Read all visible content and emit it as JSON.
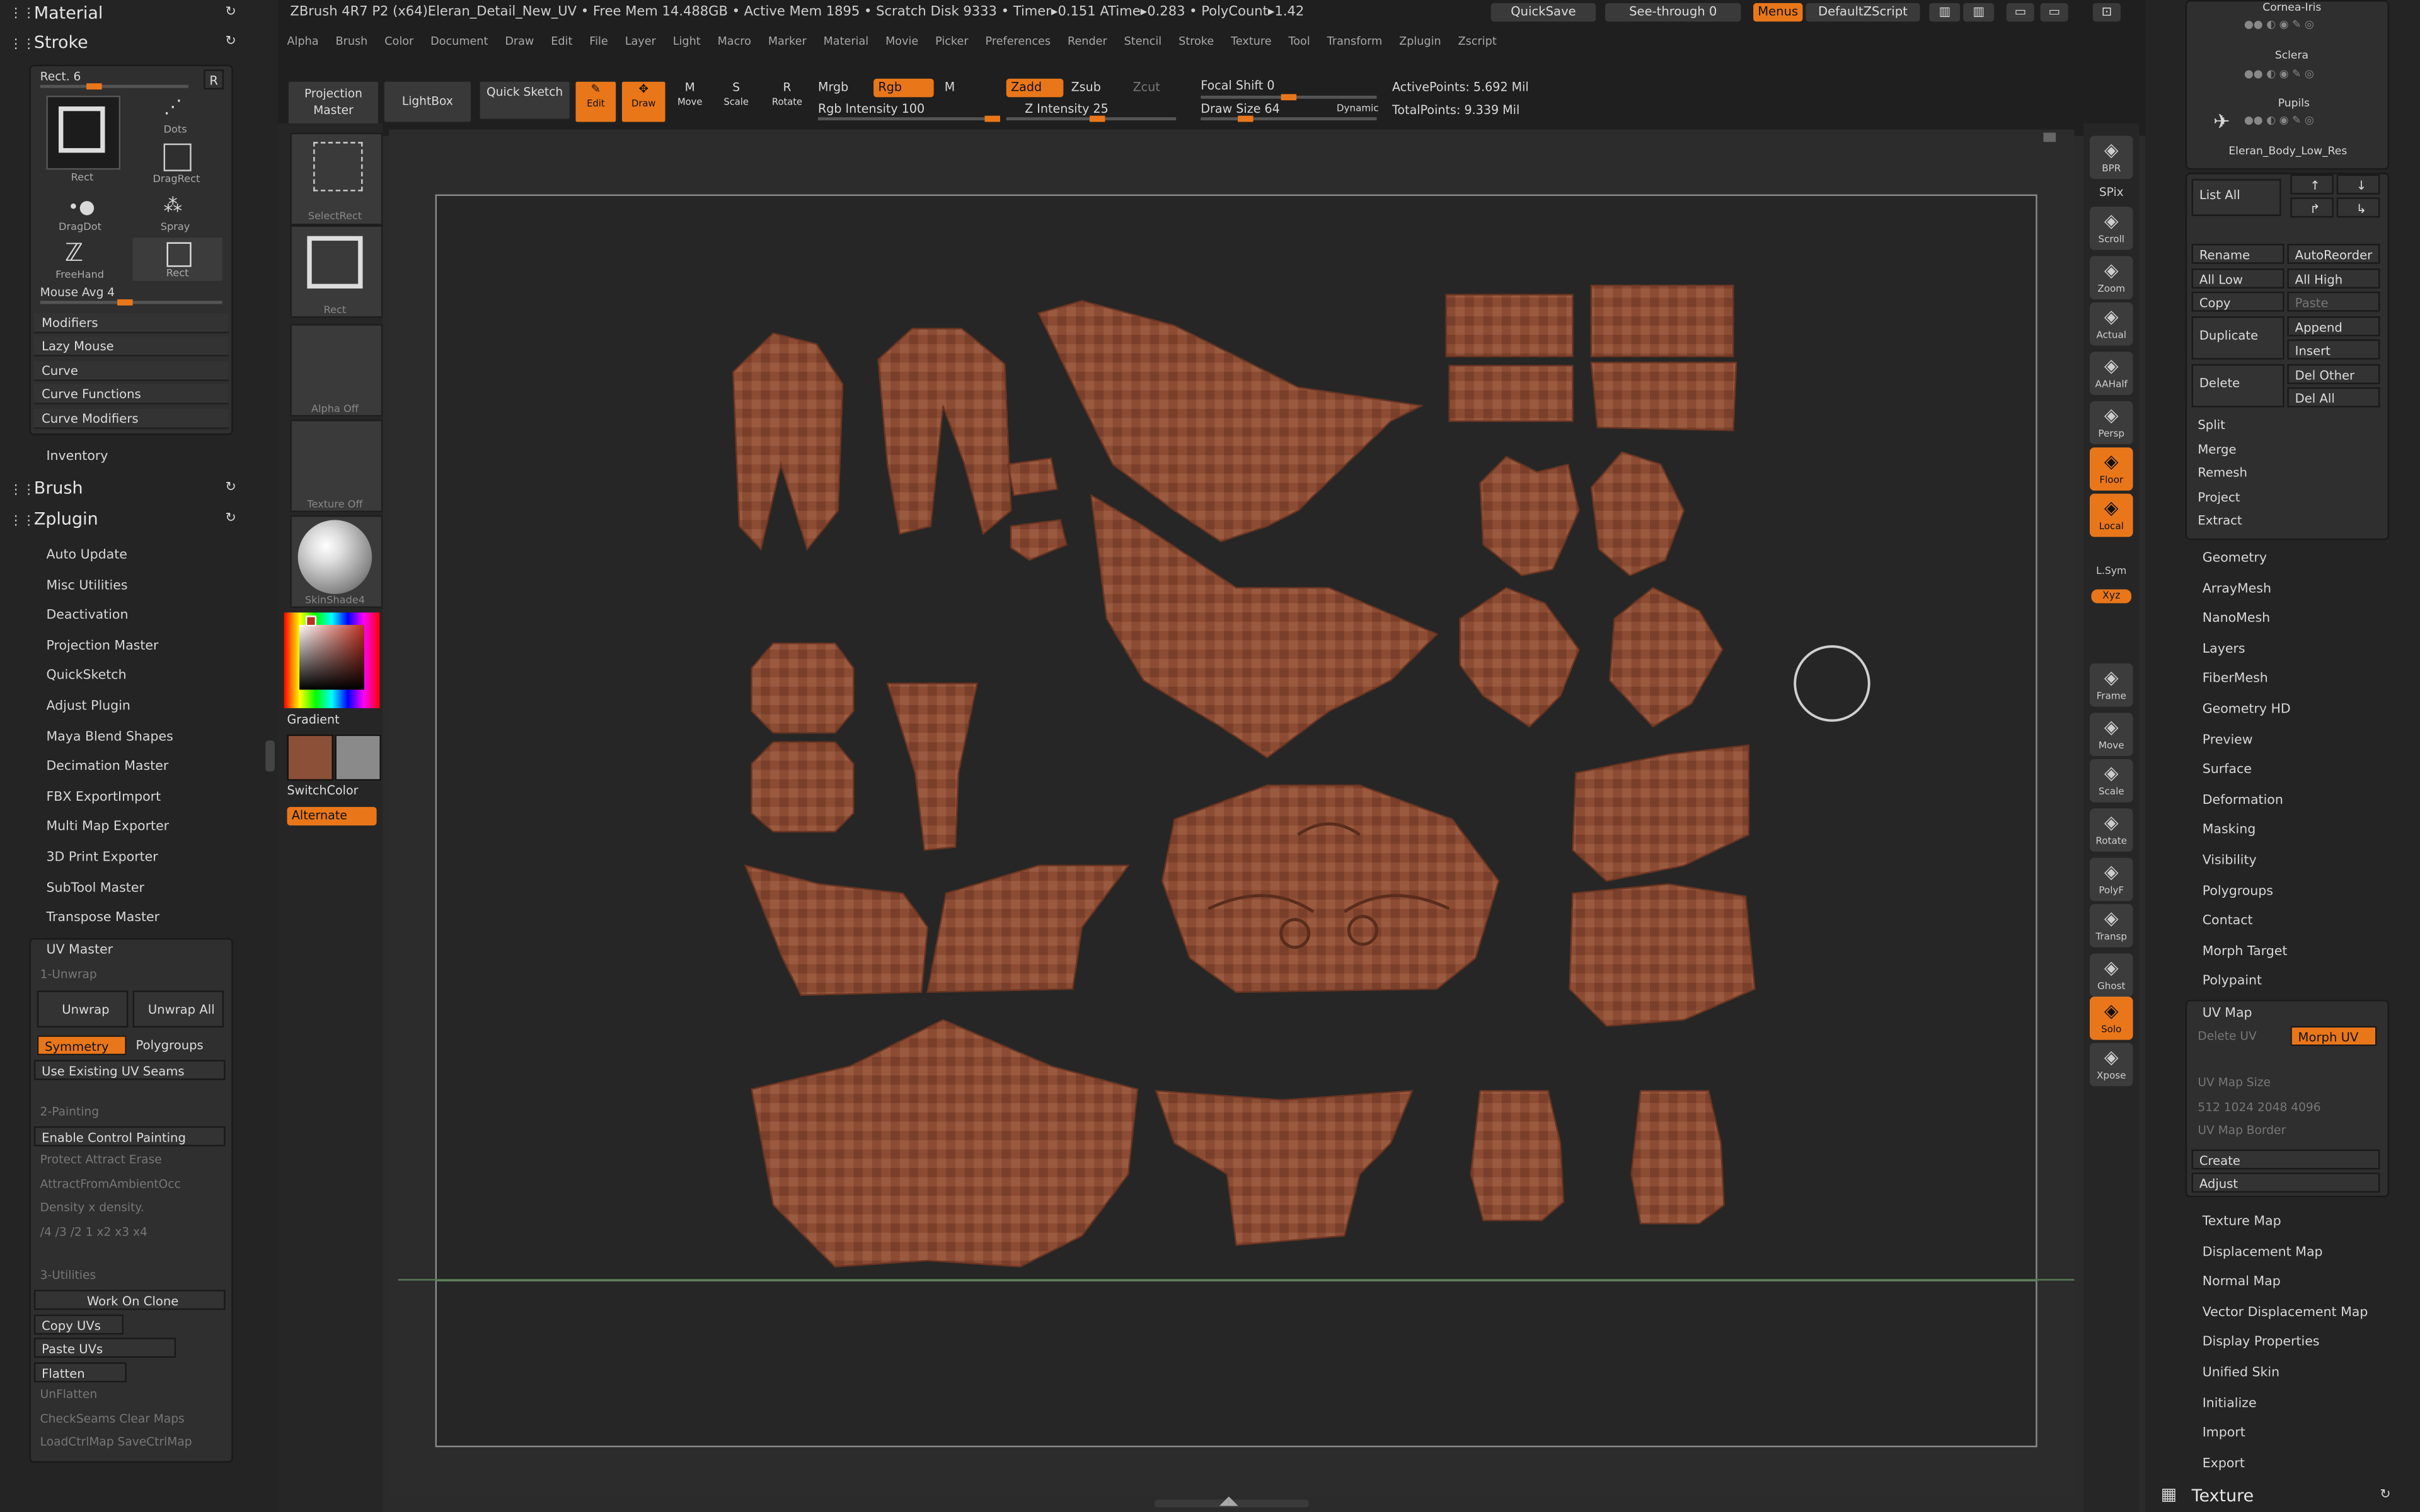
{
  "app": {
    "title": "ZBrush 4R7 P2 (x64)Eleran_Detail_New_UV",
    "status": "• Free Mem 14.488GB • Active Mem 1895 • Scratch Disk 9333 •",
    "timer": "Timer▸0.151 ATime▸0.283 • PolyCount▸1.42"
  },
  "topbar": {
    "quicksave": "QuickSave",
    "seethrough": "See-through 0",
    "menus_btn": "Menus",
    "default_script": "DefaultZScript"
  },
  "menus": [
    "Alpha",
    "Brush",
    "Color",
    "Document",
    "Draw",
    "Edit",
    "File",
    "Layer",
    "Light",
    "Macro",
    "Marker",
    "Material",
    "Movie",
    "Picker",
    "Preferences",
    "Render",
    "Stencil",
    "Stroke",
    "Texture",
    "Tool",
    "Transform",
    "Zplugin",
    "Zscript"
  ],
  "shelf": {
    "projection_master": "Projection Master",
    "lightbox": "LightBox",
    "quick_sketch": "Quick Sketch",
    "edit": "Edit",
    "draw": "Draw",
    "move": "Move",
    "scale": "Scale",
    "rotate": "Rotate",
    "mrgb": "Mrgb",
    "rgb": "Rgb",
    "m": "M",
    "zadd": "Zadd",
    "zsub": "Zsub",
    "zcut": "Zcut",
    "rgb_intensity": "Rgb Intensity 100",
    "z_intensity": "Z Intensity 25",
    "focal_shift": "Focal Shift 0",
    "draw_size": "Draw Size 64",
    "dynamic": "Dynamic",
    "active_points": "ActivePoints: 5.692 Mil",
    "total_points": "TotalPoints: 9.339 Mil"
  },
  "left": {
    "material": "Material",
    "stroke": "Stroke",
    "stroke_type": "Rect. 6",
    "r": "R",
    "strokes": [
      "Rect",
      "Dots",
      "DragRect",
      "DragDot",
      "Spray",
      "FreeHand",
      "Rect"
    ],
    "mouse_avg": "Mouse Avg 4",
    "stroke_sub": [
      "Modifiers",
      "Lazy Mouse",
      "Curve",
      "Curve Functions",
      "Curve Modifiers"
    ],
    "inventory": "Inventory",
    "brush": "Brush",
    "zplugin": "Zplugin",
    "plugins": [
      "Auto Update",
      "Misc Utilities",
      "Deactivation",
      "Projection Master",
      "QuickSketch",
      "Adjust Plugin",
      "Maya Blend Shapes",
      "Decimation Master",
      "FBX ExportImport",
      "Multi Map Exporter",
      "3D Print Exporter",
      "SubTool Master",
      "Transpose Master"
    ],
    "uvmaster": "UV Master",
    "unwrap_hdr": "1-Unwrap",
    "unwrap": "Unwrap",
    "unwrap_all": "Unwrap All",
    "symmetry": "Symmetry",
    "polygroups": "Polygroups",
    "use_seams": "Use Existing UV Seams",
    "painting_hdr": "2-Painting",
    "enable_control": "Enable Control Painting",
    "protect": "Protect Attract Erase",
    "attract_ao": "AttractFromAmbientOcc",
    "density": "Density x  density.",
    "density_vals": "/4 /3 /2  1  x2 x3 x4",
    "utilities_hdr": "3-Utilities",
    "work_on_clone": "Work On Clone",
    "copy_uvs": "Copy UVs",
    "paste_uvs": "Paste UVs",
    "flatten": "Flatten",
    "unflatten": "UnFlatten",
    "check_seams": "CheckSeams Clear Maps",
    "load_ctrl": "LoadCtrlMap SaveCtrlMap"
  },
  "toolcol": {
    "select_rect": "SelectRect",
    "rect": "Rect",
    "alpha_off": "Alpha Off",
    "texture_off": "Texture Off",
    "skinshade": "SkinShade4",
    "gradient": "Gradient",
    "switch_color": "SwitchColor",
    "alternate": "Alternate",
    "main_color": "#8a5038",
    "secondary_color": "#8a8a8a"
  },
  "rshelf": [
    "BPR",
    "SPix",
    "Scroll",
    "Zoom",
    "Actual",
    "AAHalf",
    "Persp",
    "Floor",
    "Local",
    "L.Sym",
    "Xyz",
    "Frame",
    "Move",
    "Scale",
    "Rotate",
    "PolyF",
    "Transp",
    "Ghost",
    "Solo",
    "Xpose"
  ],
  "right": {
    "subtools": [
      "Cornea-Iris",
      "Sclera",
      "Pupils",
      "Eleran_Body_Low_Res"
    ],
    "list_all": "List  All",
    "buttons": [
      [
        "Rename",
        "AutoReorder"
      ],
      [
        "All Low",
        "All High"
      ],
      [
        "Copy",
        "Paste"
      ],
      [
        "Duplicate",
        "Append"
      ],
      [
        "",
        "Insert"
      ],
      [
        "Delete",
        "Del Other"
      ],
      [
        "",
        "Del All"
      ]
    ],
    "ops": [
      "Split",
      "Merge",
      "Remesh",
      "Project",
      "Extract"
    ],
    "sections": [
      "Geometry",
      "ArrayMesh",
      "NanoMesh",
      "Layers",
      "FiberMesh",
      "Geometry HD",
      "Preview",
      "Surface",
      "Deformation",
      "Masking",
      "Visibility",
      "Polygroups",
      "Contact",
      "Morph Target",
      "Polypaint"
    ],
    "uvmap": "UV Map",
    "delete_uv": "Delete UV",
    "morph_uv": "Morph UV",
    "uv_map_size": "UV Map Size",
    "sizes": "512  1024  2048  4096",
    "uv_map_border": "UV Map Border",
    "create": "Create",
    "adjust": "Adjust",
    "sections2": [
      "Texture Map",
      "Displacement Map",
      "Normal Map",
      "Vector Displacement Map",
      "Display Properties",
      "Unified Skin",
      "Initialize",
      "Import",
      "Export"
    ],
    "texture": "Texture"
  }
}
